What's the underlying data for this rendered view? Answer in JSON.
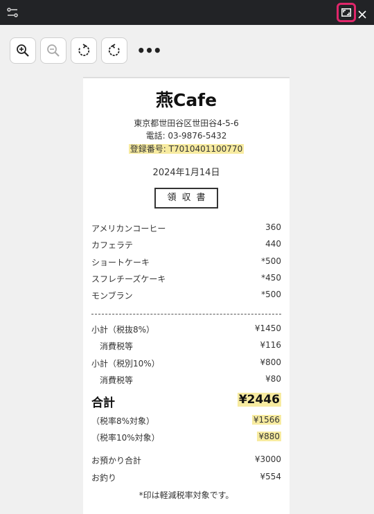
{
  "titlebar": {
    "settings_icon": "sliders-icon",
    "expand_icon": "expand-icon",
    "close_icon": "close-icon"
  },
  "toolbar": {
    "buttons": [
      "zoom-in-icon",
      "zoom-out-icon",
      "rotate-clockwise-icon",
      "rotate-counterclockwise-icon"
    ],
    "more_label": "•••"
  },
  "receipt": {
    "shop_name": "燕Cafe",
    "address": "東京都世田谷区世田谷4-5-6",
    "phone": "電話: 03-9876-5432",
    "registration": "登録番号: T7010401100770",
    "date": "2024年1月14日",
    "doc_title": "領収書",
    "items": [
      {
        "name": "アメリカンコーヒー",
        "price": "360"
      },
      {
        "name": "カフェラテ",
        "price": "440"
      },
      {
        "name": "ショートケーキ",
        "price": "*500"
      },
      {
        "name": "スフレチーズケーキ",
        "price": "*450"
      },
      {
        "name": "モンブラン",
        "price": "*500"
      }
    ],
    "subtotal_8_label": "小計（税抜8%）",
    "subtotal_8_value": "¥1450",
    "tax_8_label": "消費税等",
    "tax_8_value": "¥116",
    "subtotal_10_label": "小計（税別10%）",
    "subtotal_10_value": "¥800",
    "tax_10_label": "消費税等",
    "tax_10_value": "¥80",
    "total_label": "合計",
    "total_value": "¥2446",
    "rate8_label": "（税率8%対象）",
    "rate8_value": "¥1566",
    "rate10_label": "（税率10%対象）",
    "rate10_value": "¥880",
    "deposit_label": "お預かり合計",
    "deposit_value": "¥3000",
    "change_label": "お釣り",
    "change_value": "¥554",
    "note": "*印は軽減税率対象です。"
  },
  "colors": {
    "highlight": "#f7eba0",
    "accent_border": "#e0266a",
    "titlebar": "#222326"
  }
}
